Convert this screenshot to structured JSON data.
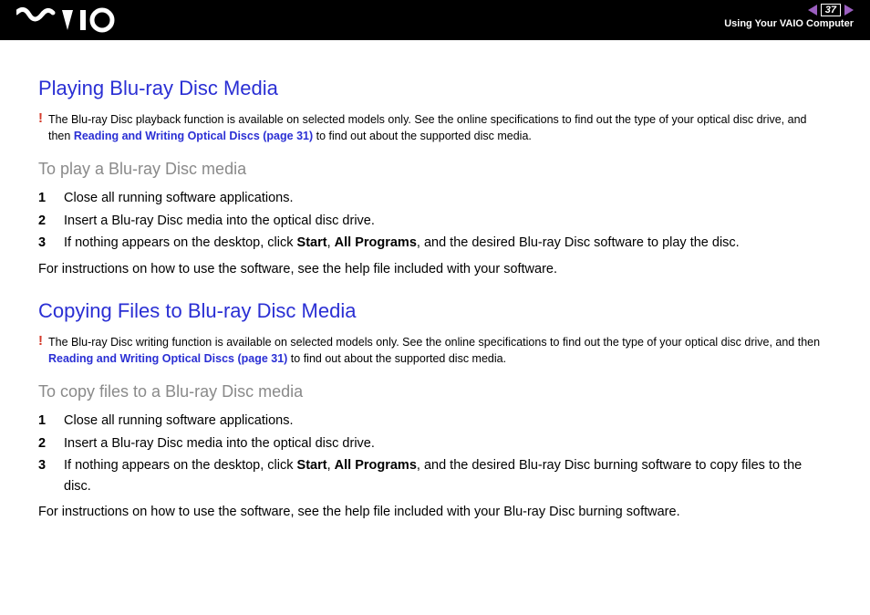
{
  "header": {
    "page_number": "37",
    "breadcrumb": "Using Your VAIO Computer"
  },
  "section1": {
    "title": "Playing Blu-ray Disc Media",
    "warn_pre": "The Blu-ray Disc playback function is available on selected models only. See the online specifications to find out the type of your optical disc drive, and then ",
    "warn_link": "Reading and Writing Optical Discs (page 31)",
    "warn_post": " to find out about the supported disc media.",
    "subtitle": "To play a Blu-ray Disc media",
    "steps": [
      {
        "n": "1",
        "pre": "Close all running software applications."
      },
      {
        "n": "2",
        "pre": "Insert a Blu-ray Disc media into the optical disc drive."
      },
      {
        "n": "3",
        "pre": "If nothing appears on the desktop, click ",
        "b1": "Start",
        "mid": ", ",
        "b2": "All Programs",
        "post": ", and the desired Blu-ray Disc software to play the disc."
      }
    ],
    "note": "For instructions on how to use the software, see the help file included with your software."
  },
  "section2": {
    "title": "Copying Files to Blu-ray Disc Media",
    "warn_pre": "The Blu-ray Disc writing function is available on selected models only. See the online specifications to find out the type of your optical disc drive, and then ",
    "warn_link": "Reading and Writing Optical Discs (page 31)",
    "warn_post": " to find out about the supported disc media.",
    "subtitle": "To copy files to a Blu-ray Disc media",
    "steps": [
      {
        "n": "1",
        "pre": "Close all running software applications."
      },
      {
        "n": "2",
        "pre": "Insert a Blu-ray Disc media into the optical disc drive."
      },
      {
        "n": "3",
        "pre": "If nothing appears on the desktop, click ",
        "b1": "Start",
        "mid": ", ",
        "b2": "All Programs",
        "post": ", and the desired Blu-ray Disc burning software to copy files to the disc."
      }
    ],
    "note": "For instructions on how to use the software, see the help file included with your Blu-ray Disc burning software."
  }
}
